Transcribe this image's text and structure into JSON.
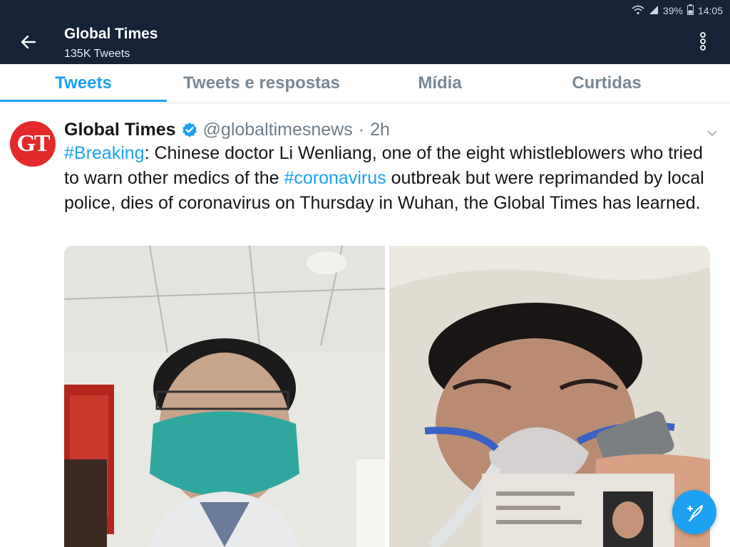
{
  "status_bar": {
    "battery": "39%",
    "time": "14:05"
  },
  "header": {
    "title": "Global Times",
    "subtitle": "135K Tweets"
  },
  "tabs": [
    {
      "label": "Tweets",
      "active": true
    },
    {
      "label": "Tweets e respostas",
      "active": false
    },
    {
      "label": "Mídia",
      "active": false
    },
    {
      "label": "Curtidas",
      "active": false
    }
  ],
  "tweet": {
    "avatar_text": "GT",
    "author_name": "Global Times",
    "handle": "@globaltimesnews",
    "separator": "·",
    "time": "2h",
    "hashtag1": "#Breaking",
    "text1": ": Chinese doctor Li Wenliang, one of the eight whistleblowers who tried to warn other medics of the ",
    "hashtag2": "#coronavirus",
    "text2": " outbreak but were reprimanded by local police, dies of coronavirus on Thursday in Wuhan, the Global Times has learned."
  },
  "colors": {
    "header_bg": "#152238",
    "accent": "#1da1f2",
    "avatar_bg": "#e22a2a"
  },
  "icons": {
    "back": "arrow-left-icon",
    "more": "more-vertical-icon",
    "verified": "verified-badge-icon",
    "caret": "chevron-down-icon",
    "compose": "compose-feather-icon"
  }
}
